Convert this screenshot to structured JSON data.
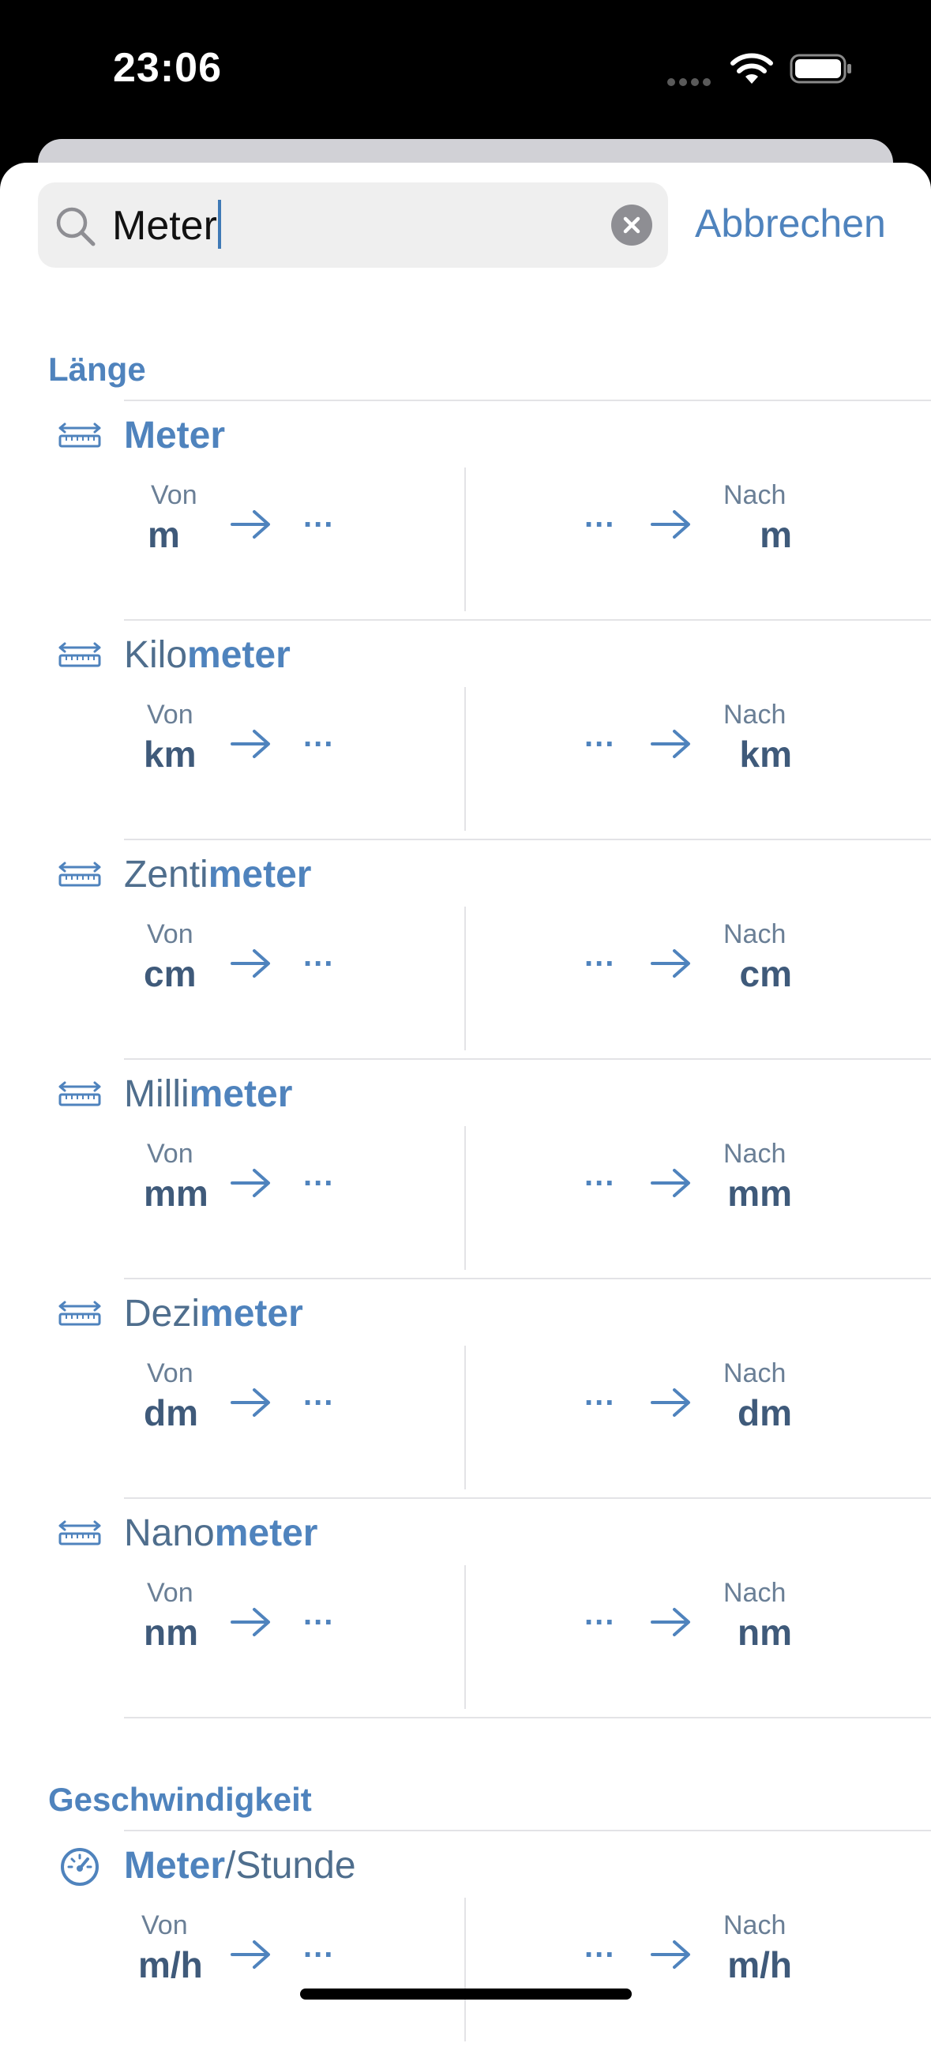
{
  "status": {
    "time": "23:06"
  },
  "search": {
    "value": "Meter",
    "cancel_label": "Abbrechen"
  },
  "colors": {
    "accent": "#4f83bd",
    "text": "#3f5a7a"
  },
  "sections": [
    {
      "title": "Länge",
      "icon": "ruler-icon",
      "rows": [
        {
          "prefix": "",
          "match": "Meter",
          "suffix": "",
          "from_label": "Von",
          "from_symbol": "m",
          "to_label": "Nach",
          "to_symbol": "m",
          "from_value": "...",
          "to_value": "..."
        },
        {
          "prefix": "Kilo",
          "match": "meter",
          "suffix": "",
          "from_label": "Von",
          "from_symbol": "km",
          "to_label": "Nach",
          "to_symbol": "km",
          "from_value": "...",
          "to_value": "..."
        },
        {
          "prefix": "Zenti",
          "match": "meter",
          "suffix": "",
          "from_label": "Von",
          "from_symbol": "cm",
          "to_label": "Nach",
          "to_symbol": "cm",
          "from_value": "...",
          "to_value": "..."
        },
        {
          "prefix": "Milli",
          "match": "meter",
          "suffix": "",
          "from_label": "Von",
          "from_symbol": "mm",
          "to_label": "Nach",
          "to_symbol": "mm",
          "from_value": "...",
          "to_value": "..."
        },
        {
          "prefix": "Dezi",
          "match": "meter",
          "suffix": "",
          "from_label": "Von",
          "from_symbol": "dm",
          "to_label": "Nach",
          "to_symbol": "dm",
          "from_value": "...",
          "to_value": "..."
        },
        {
          "prefix": "Nano",
          "match": "meter",
          "suffix": "",
          "from_label": "Von",
          "from_symbol": "nm",
          "to_label": "Nach",
          "to_symbol": "nm",
          "from_value": "...",
          "to_value": "..."
        }
      ]
    },
    {
      "title": "Geschwindigkeit",
      "icon": "speedometer-icon",
      "rows": [
        {
          "prefix": "",
          "match": "Meter",
          "suffix": "/Stunde",
          "from_label": "Von",
          "from_symbol": "m/h",
          "to_label": "Nach",
          "to_symbol": "m/h",
          "from_value": "...",
          "to_value": "..."
        }
      ]
    }
  ]
}
